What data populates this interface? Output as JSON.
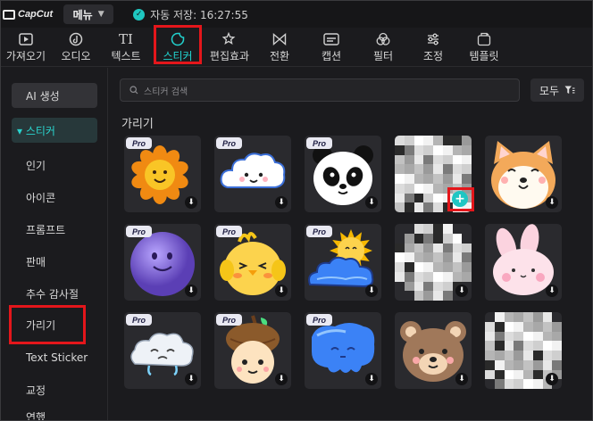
{
  "app": {
    "logo_text": "CapCut"
  },
  "titlebar": {
    "menu_label": "메뉴",
    "autosave_text": "자동 저장: 16:27:55"
  },
  "toolbar": {
    "items": [
      {
        "label": "가져오기",
        "icon": "import-icon"
      },
      {
        "label": "오디오",
        "icon": "audio-icon"
      },
      {
        "label": "텍스트",
        "icon": "text-icon"
      },
      {
        "label": "스티커",
        "icon": "sticker-icon"
      },
      {
        "label": "편집효과",
        "icon": "effects-icon"
      },
      {
        "label": "전환",
        "icon": "transition-icon"
      },
      {
        "label": "캡션",
        "icon": "caption-icon"
      },
      {
        "label": "필터",
        "icon": "filter-icon"
      },
      {
        "label": "조정",
        "icon": "adjust-icon"
      },
      {
        "label": "템플릿",
        "icon": "template-icon"
      }
    ],
    "active": "스티커"
  },
  "sidebar": {
    "items": [
      {
        "label": "AI 생성"
      },
      {
        "label": "▾ 스티커"
      },
      {
        "label": "인기"
      },
      {
        "label": "아이콘"
      },
      {
        "label": "프롬프트"
      },
      {
        "label": "판매"
      },
      {
        "label": "추수 감사절"
      },
      {
        "label": "가리기"
      },
      {
        "label": "Text Sticker"
      },
      {
        "label": "교정"
      },
      {
        "label": "연했"
      }
    ]
  },
  "main": {
    "search_placeholder": "스티커 검색",
    "filter_label": "모두",
    "section_title": "가리기",
    "pro_badge": "Pro",
    "stickers": [
      {
        "name": "sun-flower",
        "pro": true
      },
      {
        "name": "cloud",
        "pro": true
      },
      {
        "name": "panda",
        "pro": true
      },
      {
        "name": "pixel-mosaic-square",
        "pro": false
      },
      {
        "name": "corgi",
        "pro": false
      },
      {
        "name": "purple-fluff-ball",
        "pro": true
      },
      {
        "name": "yellow-chick",
        "pro": true
      },
      {
        "name": "sun-behind-cloud",
        "pro": true
      },
      {
        "name": "pixel-mosaic-circle",
        "pro": false
      },
      {
        "name": "pink-bunny",
        "pro": false
      },
      {
        "name": "crying-cloud",
        "pro": true
      },
      {
        "name": "acorn-character",
        "pro": true
      },
      {
        "name": "blue-blob",
        "pro": true
      },
      {
        "name": "bear-face",
        "pro": false
      },
      {
        "name": "pixel-mosaic-blob",
        "pro": false
      }
    ]
  },
  "colors": {
    "accent": "#22d3cf",
    "highlight": "#e4161b",
    "background": "#1b1b1e"
  }
}
